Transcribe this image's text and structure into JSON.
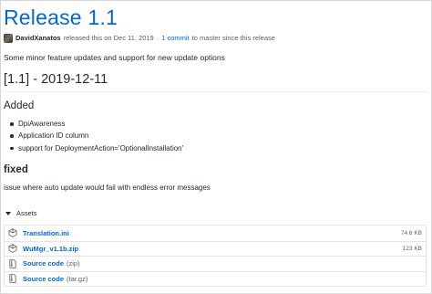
{
  "release": {
    "title": "Release 1.1",
    "author": "DavidXanatos",
    "released_text": "released this on Dec 11, 2019",
    "commits_link": "1 commit",
    "commits_suffix": "to master since this release",
    "intro": "Some minor feature updates and support for new update options"
  },
  "changelog": {
    "version_heading": "[1.1] - 2019-12-11",
    "added_heading": "Added",
    "added_items": [
      "DpiAwareness",
      "Application ID column",
      "support for DeploymentAction='OptionalInstallation'"
    ],
    "fixed_heading": "fixed",
    "fixed_text": "issue where auto update would fail with endless error messages"
  },
  "assets": {
    "heading": "Assets",
    "badge_count": "4",
    "items": [
      {
        "name": "Translation.ini",
        "size": "74.6 KB",
        "icon": "package-icon"
      },
      {
        "name": "WuMgr_v1.1b.zip",
        "size": "123 KB",
        "icon": "package-icon"
      },
      {
        "name": "Source code",
        "suffix": "(zip)",
        "icon": "file-zip-icon"
      },
      {
        "name": "Source code",
        "suffix": "(tar.gz)",
        "icon": "file-zip-icon"
      }
    ]
  },
  "colors": {
    "link": "#0366d6",
    "text": "#24292e",
    "muted": "#586069"
  }
}
